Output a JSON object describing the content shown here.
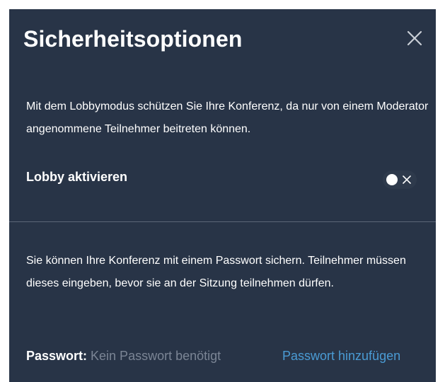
{
  "dialog": {
    "title": "Sicherheitsoptionen",
    "close_icon": "close-icon"
  },
  "lobby": {
    "description": "Mit dem Lobbymodus schützen Sie Ihre Konferenz, da nur von einem Moderator angenommene Teilnehmer beitreten können.",
    "label": "Lobby aktivieren",
    "enabled": false
  },
  "password": {
    "description": "Sie können Ihre Konferenz mit einem Passwort sichern. Teilnehmer müssen dieses eingeben, bevor sie an der Sitzung teilnehmen dürfen.",
    "label": "Passwort:",
    "status": "Kein Passwort benötigt",
    "add_link": "Passwort hinzufügen"
  },
  "colors": {
    "background": "#283447",
    "text": "#ffffff",
    "muted": "#7b8595",
    "link": "#4a9bd4"
  }
}
